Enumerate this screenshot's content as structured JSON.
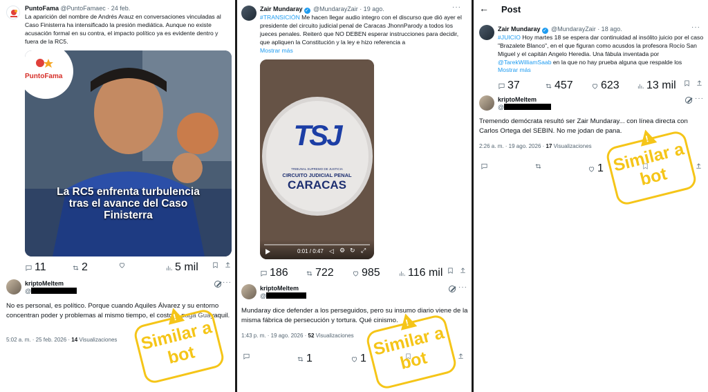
{
  "panel1": {
    "quoted": {
      "display_name": "PuntoFama",
      "handle_date": "@PuntoFamaec · 24 feb.",
      "text": "La aparición del nombre de Andrés Arauz en conversaciones vinculadas al Caso Finisterra ha intensificado la presión mediática. Aunque no existe acusación formal en su contra, el impacto político ya es evidente dentro y fuera de la RC5.",
      "logo_text": "PuntoFama",
      "image_headline": "La RC5 enfrenta turbulencia tras el avance del Caso Finisterra",
      "stats": {
        "replies": "11",
        "reposts": "2",
        "likes": "",
        "views": "5 mil"
      }
    },
    "reply": {
      "display_name": "kriptoMeltem",
      "handle": "@",
      "text": "No es personal, es político. Porque cuando Aquiles Álvarez y su entorno concentran poder y problemas al mismo tiempo, el costo lo paga Guayaquil.",
      "timestamp": "5:02 a. m. · 25 feb. 2026 · ",
      "views_count": "14",
      "views_label": " Visualizaciones"
    },
    "stamp": "Similar a bot"
  },
  "panel2": {
    "quoted": {
      "display_name": "Zair Mundaray",
      "handle_date": "@MundarayZair · 19 ago.",
      "hashtag": "#TRANSICIÓN",
      "text": " Me hacen llegar audio integro con el discurso que dió ayer el presidente del circuito judicial penal de Caracas JhonnParody a todos los jueces penales. Reiteró que  NO DEBEN esperar instrucciones para decidir, que apliquen la Constitución y la ley e hizo referencia a",
      "show_more": "Mostrar más",
      "sign_logo": "TSJ",
      "sign_small": "TRIBUNAL SUPREMO DE JUSTICIA",
      "sign_mid": "CIRCUITO JUDICIAL PENAL",
      "sign_big": "CARACAS",
      "video_time": "0:01 / 0:47",
      "stats": {
        "replies": "186",
        "reposts": "722",
        "likes": "985",
        "views": "116 mil"
      }
    },
    "reply": {
      "display_name": "kriptoMeltem",
      "handle": "@",
      "text": "Mundaray dice defender a los perseguidos, pero su insumo diario viene de la misma fábrica de persecución y tortura. Qué cinismo.",
      "timestamp": "1:43 p. m. · 19 ago. 2026 · ",
      "views_count": "52",
      "views_label": " Visualizaciones",
      "stats": {
        "reposts": "1",
        "likes": "1"
      }
    },
    "stamp": "Similar a bot"
  },
  "panel3": {
    "header": {
      "back": "←",
      "title": "Post"
    },
    "quoted": {
      "display_name": "Zair Mundaray",
      "handle_date": "@MundarayZair · 18 ago.",
      "hashtag": "#JUICIO",
      "text": " Hoy martes 18 se espera dar continuidad al insólito juicio por el caso \"Brazalete Blanco\", en el que figuran como acusdos la profesora Rocío San Miguel y el capitán Angelo Heredia. Una fábula inventada por ",
      "mention": "@TarekWilliamSaab",
      "text2": "  en la que no hay prueba alguna que respalde los",
      "show_more": "Mostrar más",
      "stats": {
        "replies": "37",
        "reposts": "457",
        "likes": "623",
        "views": "13 mil"
      }
    },
    "reply": {
      "display_name": "kriptoMeltem",
      "handle": "@",
      "text": "Tremendo demócrata resultó ser Zair Mundaray... con línea directa con Carlos Ortega del SEBIN. No me jodan de pana.",
      "timestamp": "2:26 a. m. · 19 ago. 2026 · ",
      "views_count": "17",
      "views_label": " Visualizaciones",
      "stats": {
        "likes": "1"
      }
    },
    "stamp": "Similar a bot"
  }
}
